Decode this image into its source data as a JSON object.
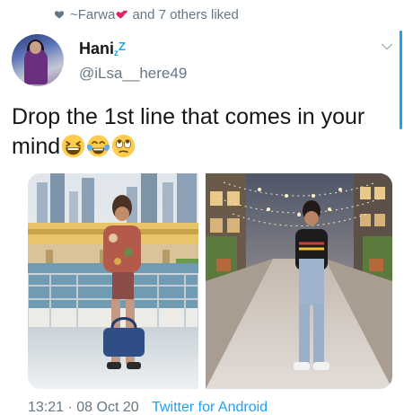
{
  "social_context": {
    "name": "~Farwa",
    "suffix": "and 7 others liked",
    "icon": "heart-icon",
    "name_emoji": "two-hearts-emoji"
  },
  "author": {
    "display_name": "Hani",
    "display_name_decoration": [
      "z",
      "Z"
    ],
    "handle": "@iLsa__here49",
    "avatar": "avatar-image"
  },
  "tweet": {
    "text": "Drop the 1st line that comes in your mind",
    "emojis": [
      "grinning-squinting-emoji",
      "tears-of-joy-emoji",
      "rolling-eyes-emoji"
    ]
  },
  "media": [
    {
      "name": "photo-left",
      "alt": ""
    },
    {
      "name": "photo-right",
      "alt": ""
    }
  ],
  "meta": {
    "time": "13:21",
    "date": "08 Oct 20",
    "source": "Twitter for Android"
  },
  "colors": {
    "accent": "#1da1f2",
    "secondary_text": "#657786",
    "primary_text": "#14171a"
  }
}
